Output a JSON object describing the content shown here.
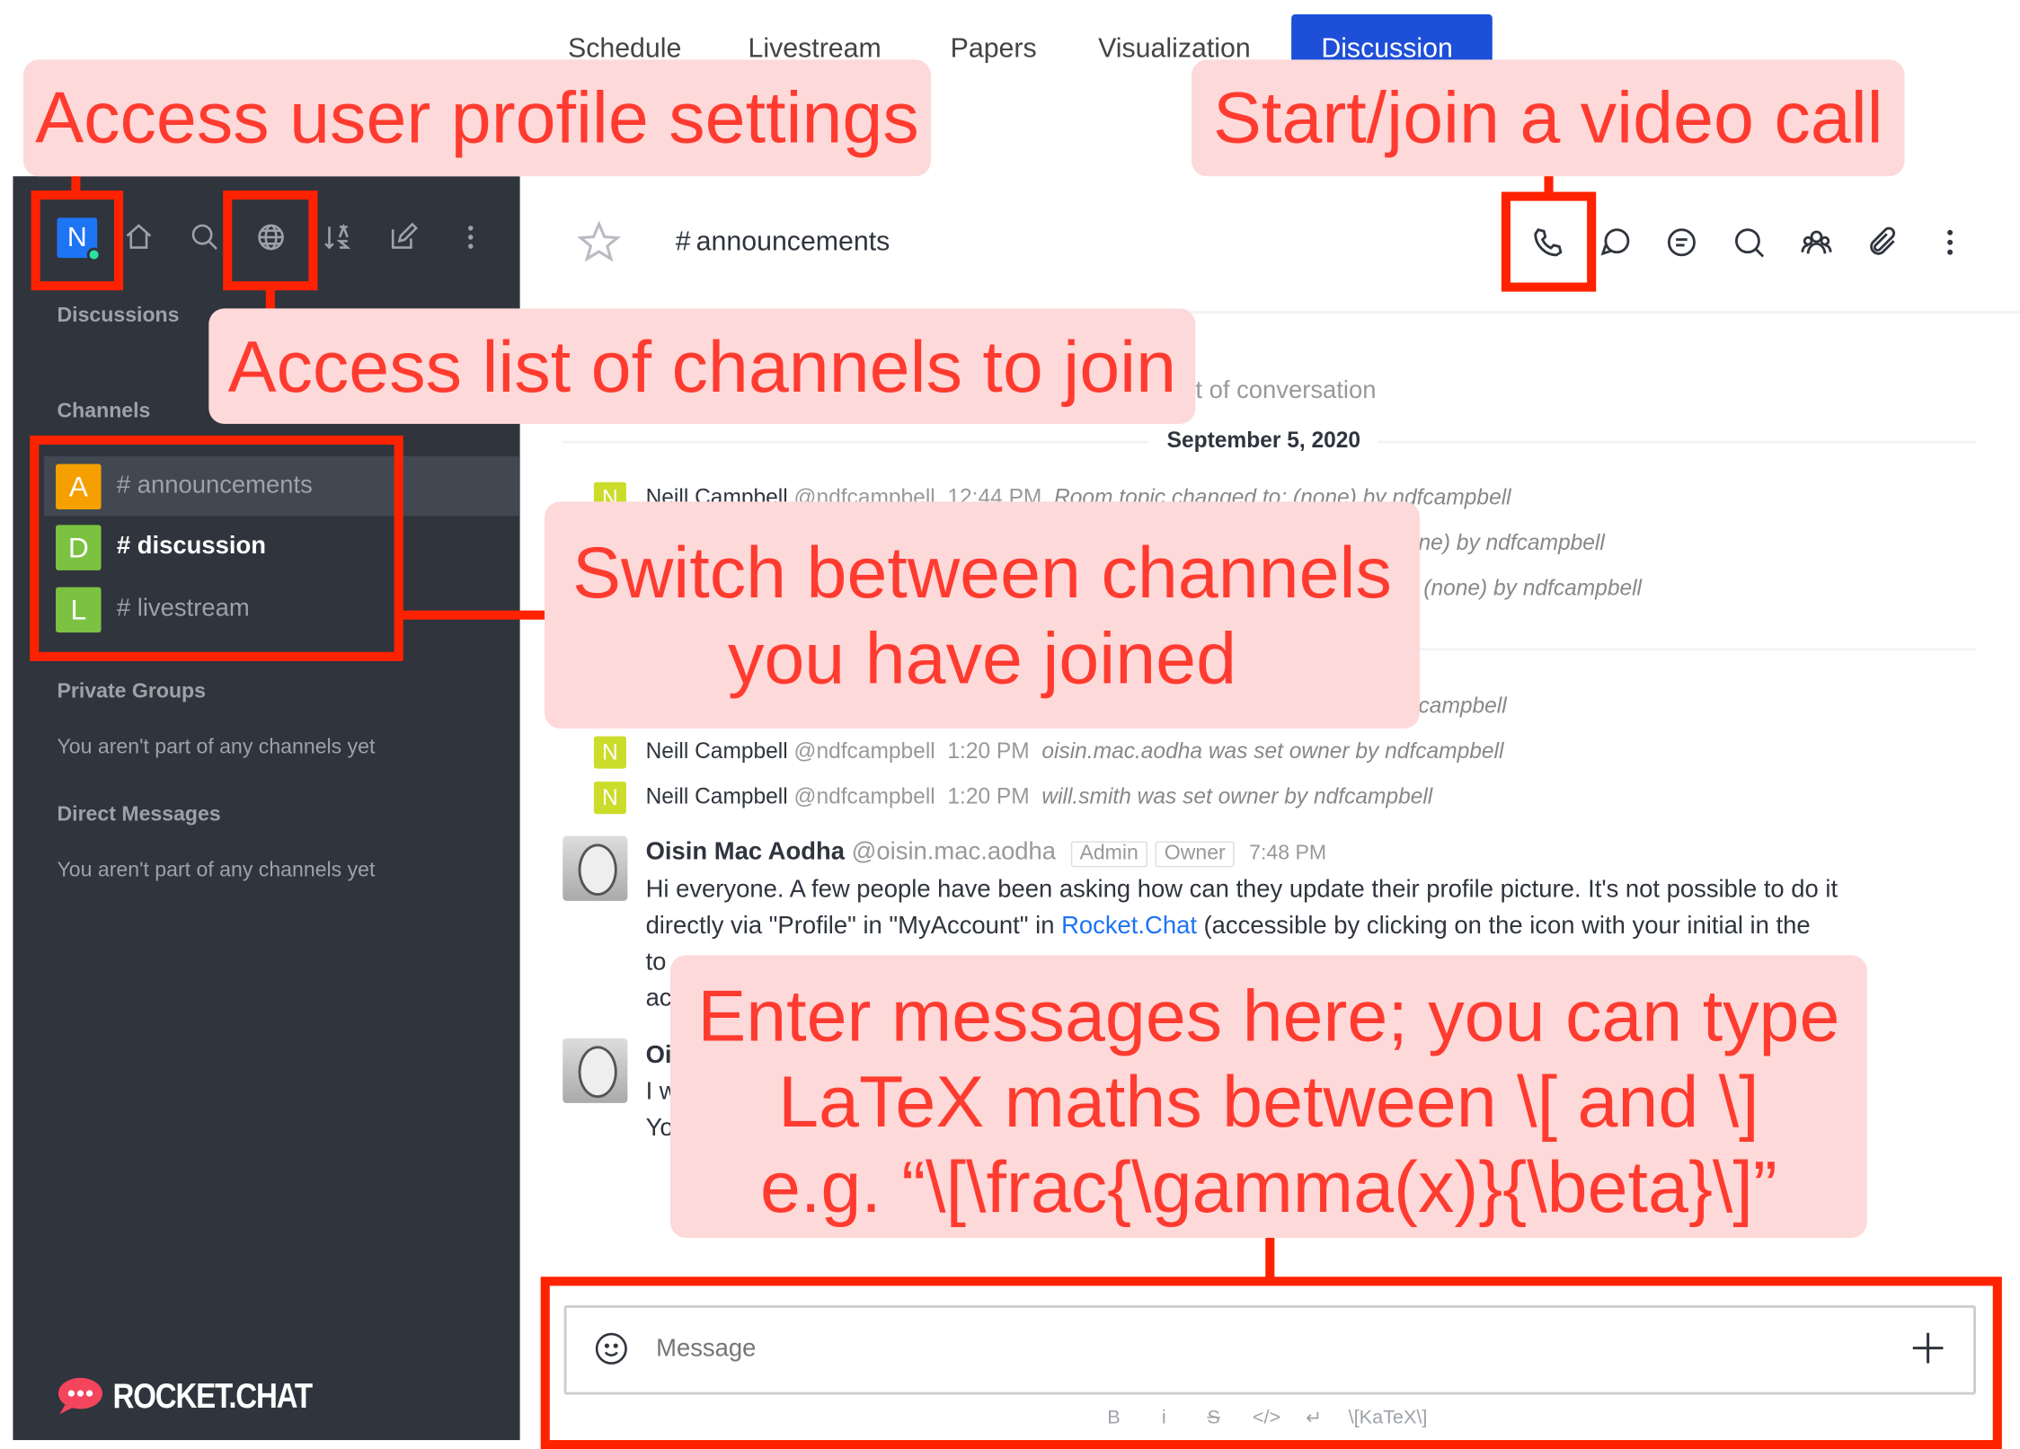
{
  "top_tabs": [
    "Schedule",
    "Livestream",
    "Papers",
    "Visualization",
    "Discussion"
  ],
  "active_tab": "Discussion",
  "colors": {
    "sidebar_bg": "#2f343d",
    "accent": "#1d4fd8",
    "annotation_bg": "#fdd9d9",
    "annotation_text": "#ff3b30",
    "highlight_outline": "#ff2200",
    "link": "#1d74f5"
  },
  "sidebar": {
    "user_initial": "N",
    "icons": [
      "home-icon",
      "search-icon",
      "globe-icon",
      "sort-icon",
      "edit-icon",
      "kebab-icon"
    ],
    "discussions_label": "Discussions",
    "channels_label": "Channels",
    "channels": [
      {
        "initial": "A",
        "name": "announcements",
        "color": "#f5a000",
        "active": true
      },
      {
        "initial": "D",
        "name": "discussion",
        "color": "#7cc242",
        "unread": true
      },
      {
        "initial": "L",
        "name": "livestream",
        "color": "#7cc242"
      }
    ],
    "private_groups_label": "Private Groups",
    "private_groups_empty": "You aren't part of any channels yet",
    "direct_messages_label": "Direct Messages",
    "direct_messages_empty": "You aren't part of any channels yet",
    "logo_text": "ROCKET.CHAT"
  },
  "room": {
    "name": "announcements",
    "header_icons": [
      "phone-icon",
      "discussion-icon",
      "threads-icon",
      "search-icon",
      "members-icon",
      "attachment-icon",
      "kebab-icon"
    ]
  },
  "messages": {
    "start_fragment": "t of conversation",
    "date_divider": "September 5, 2020",
    "system": [
      {
        "initial": "N",
        "name": "Neill Campbell",
        "handle": "@ndfcampbell",
        "time": "12:44 PM",
        "text": "Room topic changed to: (none) by ndfcampbell"
      },
      {
        "fragment": "ne) by ndfcampbell"
      },
      {
        "fragment": "(none) by ndfcampbell"
      },
      {
        "fragment": "campbell"
      },
      {
        "initial": "N",
        "name": "Neill Campbell",
        "handle": "@ndfcampbell",
        "time": "1:20 PM",
        "text": "oisin.mac.aodha was set owner by ndfcampbell"
      },
      {
        "initial": "N",
        "name": "Neill Campbell",
        "handle": "@ndfcampbell",
        "time": "1:20 PM",
        "text": "will.smith was set owner by ndfcampbell"
      }
    ],
    "post": {
      "name": "Oisin Mac Aodha",
      "handle": "@oisin.mac.aodha",
      "badges": [
        "Admin",
        "Owner"
      ],
      "time": "7:48 PM",
      "line1": "Hi everyone. A few people have been asking how can they update their profile picture. It's not possible to do it",
      "line2_before": "directly via \"Profile\" in \"MyAccount\" in ",
      "line2_link": "Rocket.Chat",
      "line2_after": " (accessible by clicking on the icon with your initial in the",
      "line3": "to",
      "line4": "ac"
    },
    "post2": {
      "name_fragment": "Oi",
      "line1": "I w",
      "line2": "Yo"
    }
  },
  "composer": {
    "placeholder": "Message",
    "toolbar": [
      "B",
      "i",
      "S",
      "</>",
      "↵",
      "\\[KaTeX\\]"
    ]
  },
  "annotations": {
    "profile": "Access user profile settings",
    "video": "Start/join a video call",
    "directory": "Access list of channels to join",
    "switch_line1": "Switch between channels",
    "switch_line2": "you have joined",
    "enter_line1": "Enter messages here; you can type",
    "enter_line2": "LaTeX maths between \\[ and \\]",
    "enter_line3": "e.g. “\\[\\frac{\\gamma(x)}{\\beta}\\]”"
  }
}
